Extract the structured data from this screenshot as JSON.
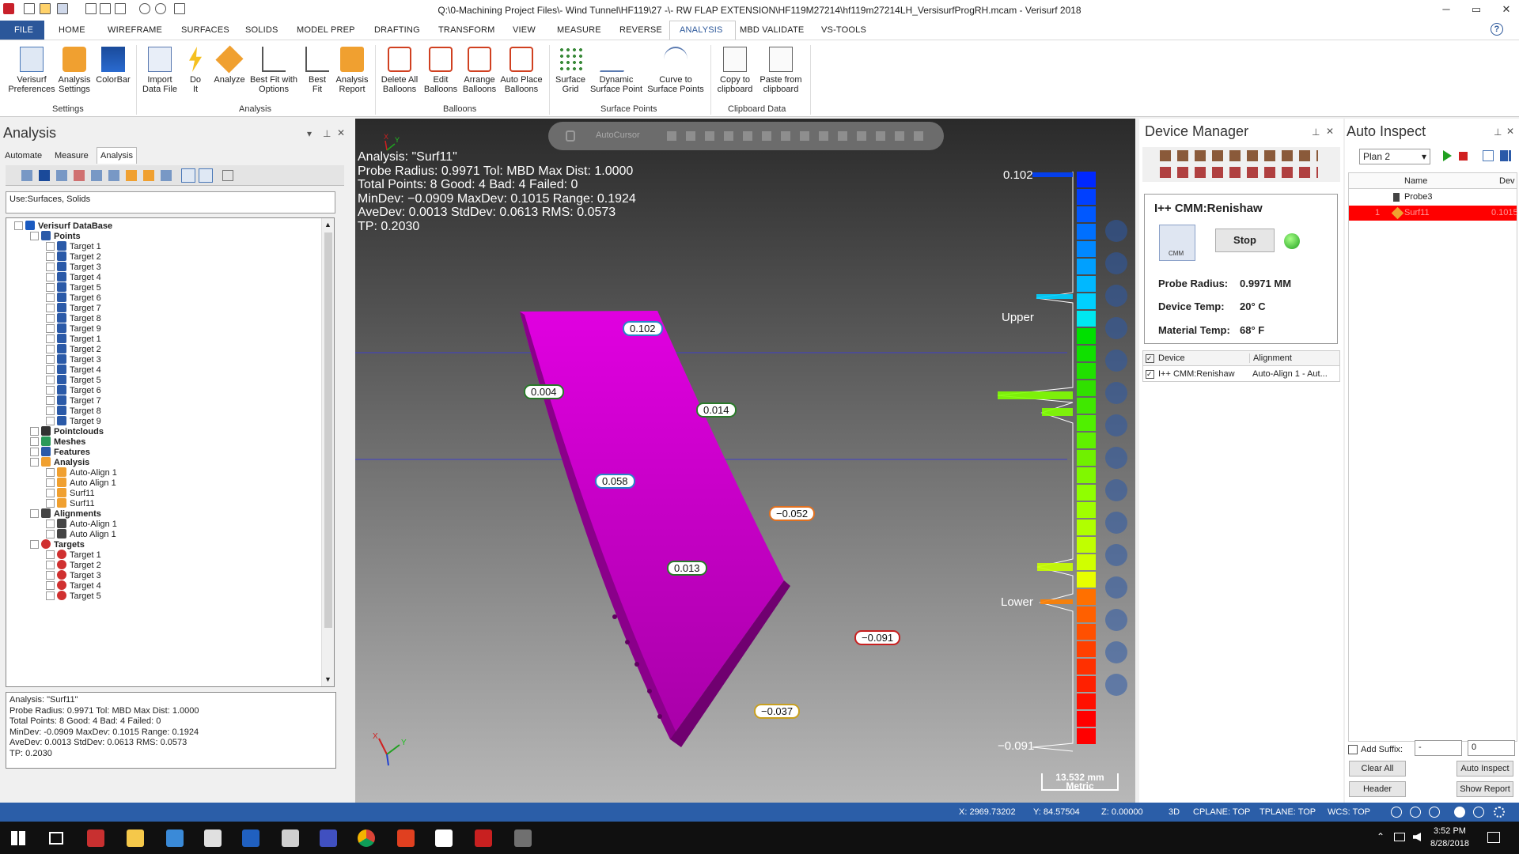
{
  "window": {
    "title": "Q:\\0-Machining Project Files\\- Wind Tunnel\\HF119\\27 -\\- RW FLAP EXTENSION\\HF119M27214\\hf119m27214LH_VersisurfProgRH.mcam - Verisurf 2018",
    "min": "─",
    "max": "▭",
    "close": "✕"
  },
  "tabs": [
    "FILE",
    "HOME",
    "WIREFRAME",
    "SURFACES",
    "SOLIDS",
    "MODEL PREP",
    "DRAFTING",
    "TRANSFORM",
    "VIEW",
    "MEASURE",
    "REVERSE",
    "ANALYSIS",
    "MBD VALIDATE",
    "VS-TOOLS"
  ],
  "help": "?",
  "ribbon": {
    "settings": {
      "label": "Settings",
      "b1a": "Verisurf",
      "b1b": "Preferences",
      "b2a": "Analysis",
      "b2b": "Settings",
      "b3a": "ColorBar"
    },
    "analysis": {
      "label": "Analysis",
      "b1a": "Import",
      "b1b": "Data File",
      "b2a": "Do",
      "b2b": "It",
      "b3a": "Analyze",
      "b4a": "Best Fit with",
      "b4b": "Options",
      "b5a": "Best",
      "b5b": "Fit",
      "b6a": "Analysis",
      "b6b": "Report"
    },
    "balloons": {
      "label": "Balloons",
      "b1a": "Delete All",
      "b1b": "Balloons",
      "b2a": "Edit",
      "b2b": "Balloons",
      "b3a": "Arrange",
      "b3b": "Balloons",
      "b4a": "Auto Place",
      "b4b": "Balloons"
    },
    "surface_points": {
      "label": "Surface Points",
      "b1a": "Surface",
      "b1b": "Grid",
      "b2a": "Dynamic",
      "b2b": "Surface Point",
      "b3a": "Curve to",
      "b3b": "Surface Points"
    },
    "clipboard": {
      "label": "Clipboard Data",
      "b1a": "Copy to",
      "b1b": "clipboard",
      "b2a": "Paste from",
      "b2b": "clipboard"
    }
  },
  "left": {
    "title": "Analysis",
    "subtabs": [
      "Automate",
      "Measure",
      "Analysis"
    ],
    "use_field": "Use:Surfaces, Solids",
    "tree": [
      {
        "label": "Verisurf DataBase",
        "level": 0,
        "bold": true,
        "icon": "database-icon"
      },
      {
        "label": "Points",
        "level": 1,
        "bold": true,
        "icon": "points-icon"
      },
      {
        "label": "Target 1",
        "level": 2,
        "icon": "point-icon"
      },
      {
        "label": "Target 2",
        "level": 2,
        "icon": "point-icon"
      },
      {
        "label": "Target 3",
        "level": 2,
        "icon": "point-icon"
      },
      {
        "label": "Target 4",
        "level": 2,
        "icon": "point-icon"
      },
      {
        "label": "Target 5",
        "level": 2,
        "icon": "point-icon"
      },
      {
        "label": "Target 6",
        "level": 2,
        "icon": "point-icon"
      },
      {
        "label": "Target 7",
        "level": 2,
        "icon": "point-icon"
      },
      {
        "label": "Target 8",
        "level": 2,
        "icon": "point-icon"
      },
      {
        "label": "Target 9",
        "level": 2,
        "icon": "point-icon"
      },
      {
        "label": "Target 1",
        "level": 2,
        "icon": "point-icon"
      },
      {
        "label": "Target 2",
        "level": 2,
        "icon": "point-icon"
      },
      {
        "label": "Target 3",
        "level": 2,
        "icon": "point-icon"
      },
      {
        "label": "Target 4",
        "level": 2,
        "icon": "point-icon"
      },
      {
        "label": "Target 5",
        "level": 2,
        "icon": "point-icon"
      },
      {
        "label": "Target 6",
        "level": 2,
        "icon": "point-icon"
      },
      {
        "label": "Target 7",
        "level": 2,
        "icon": "point-icon"
      },
      {
        "label": "Target 8",
        "level": 2,
        "icon": "point-icon"
      },
      {
        "label": "Target 9",
        "level": 2,
        "icon": "point-icon"
      },
      {
        "label": "Pointclouds",
        "level": 1,
        "bold": true,
        "icon": "pointcloud-icon"
      },
      {
        "label": "Meshes",
        "level": 1,
        "bold": true,
        "icon": "mesh-icon"
      },
      {
        "label": "Features",
        "level": 1,
        "bold": true,
        "icon": "feature-icon"
      },
      {
        "label": "Analysis",
        "level": 1,
        "bold": true,
        "icon": "analysis-icon"
      },
      {
        "label": "Auto-Align 1",
        "level": 2,
        "icon": "analysis-item-icon"
      },
      {
        "label": "Auto Align 1",
        "level": 2,
        "icon": "analysis-item-icon"
      },
      {
        "label": "Surf11",
        "level": 2,
        "icon": "analysis-item-icon"
      },
      {
        "label": "Surf11",
        "level": 2,
        "icon": "analysis-item-icon"
      },
      {
        "label": "Alignments",
        "level": 1,
        "bold": true,
        "icon": "alignment-icon"
      },
      {
        "label": "Auto-Align 1",
        "level": 2,
        "icon": "alignment-item-icon"
      },
      {
        "label": "Auto Align 1",
        "level": 2,
        "icon": "alignment-item-icon"
      },
      {
        "label": "Targets",
        "level": 1,
        "bold": true,
        "icon": "target-icon"
      },
      {
        "label": "Target 1",
        "level": 2,
        "icon": "target-item-icon"
      },
      {
        "label": "Target 2",
        "level": 2,
        "icon": "target-item-icon"
      },
      {
        "label": "Target 3",
        "level": 2,
        "icon": "target-item-icon"
      },
      {
        "label": "Target 4",
        "level": 2,
        "icon": "target-item-icon"
      },
      {
        "label": "Target 5",
        "level": 2,
        "icon": "target-item-icon"
      }
    ],
    "info": [
      "Analysis: \"Surf11\"",
      "Probe Radius: 0.9971 Tol: MBD Max Dist: 1.0000",
      "Total Points: 8 Good: 4 Bad: 4 Failed: 0",
      "MinDev: -0.0909 MaxDev: 0.1015 Range: 0.1924",
      "AveDev: 0.0013 StdDev: 0.0613 RMS: 0.0573",
      "TP: 0.2030"
    ]
  },
  "viewport": {
    "autocursor": "AutoCursor",
    "overlay": "Analysis: \"Surf11\"\nProbe Radius: 0.9971 Tol: MBD Max Dist: 1.0000\nTotal Points: 8 Good: 4 Bad: 4 Failed: 0\nMinDev: −0.0909 MaxDev: 0.1015 Range: 0.1924\nAveDev: 0.0013 StdDev: 0.0613 RMS: 0.0573\nTP: 0.2030",
    "balloons": [
      "0.102",
      "0.004",
      "0.014",
      "0.058",
      "−0.052",
      "0.013",
      "−0.091",
      "−0.037"
    ],
    "colorbar": {
      "max": "0.102",
      "upper": "Upper",
      "lower": "Lower",
      "min": "−0.091"
    },
    "scale": {
      "value": "13.532 mm",
      "unit": "Metric"
    },
    "part_color": "#cc00cc",
    "axis": {
      "x": "X",
      "y": "Y"
    }
  },
  "device_manager": {
    "title": "Device Manager",
    "device_name": "I++ CMM:Renishaw",
    "cmm_label": "CMM",
    "stop": "Stop",
    "probe_radius_label": "Probe Radius:",
    "probe_radius": "0.9971 MM",
    "device_temp_label": "Device Temp:",
    "device_temp": "20° C",
    "material_temp_label": "Material Temp:",
    "material_temp": "68° F",
    "col_device": "Device",
    "col_alignment": "Alignment",
    "row_device": "I++ CMM:Renishaw",
    "row_alignment": "Auto-Align 1 - Aut..."
  },
  "auto_inspect": {
    "title": "Auto Inspect",
    "plan": "Plan 2",
    "col_name": "Name",
    "col_dev": "Dev",
    "row1_name": "Probe3",
    "row2_num": "1",
    "row2_name": "Surf11",
    "row2_dev": "0.1015",
    "add_suffix": "Add Suffix:",
    "suffix_value": "-",
    "suffix_num": "0",
    "clear_all": "Clear All",
    "auto_inspect_btn": "Auto Inspect",
    "header": "Header",
    "show_report": "Show Report"
  },
  "status": {
    "x": "X:  2969.73202",
    "y": "Y:  84.57504",
    "z": "Z:  0.00000",
    "mode": "3D",
    "cplane": "CPLANE: TOP",
    "tplane": "TPLANE: TOP",
    "wcs": "WCS: TOP"
  },
  "taskbar": {
    "time": "3:52 PM",
    "date": "8/28/2018"
  }
}
